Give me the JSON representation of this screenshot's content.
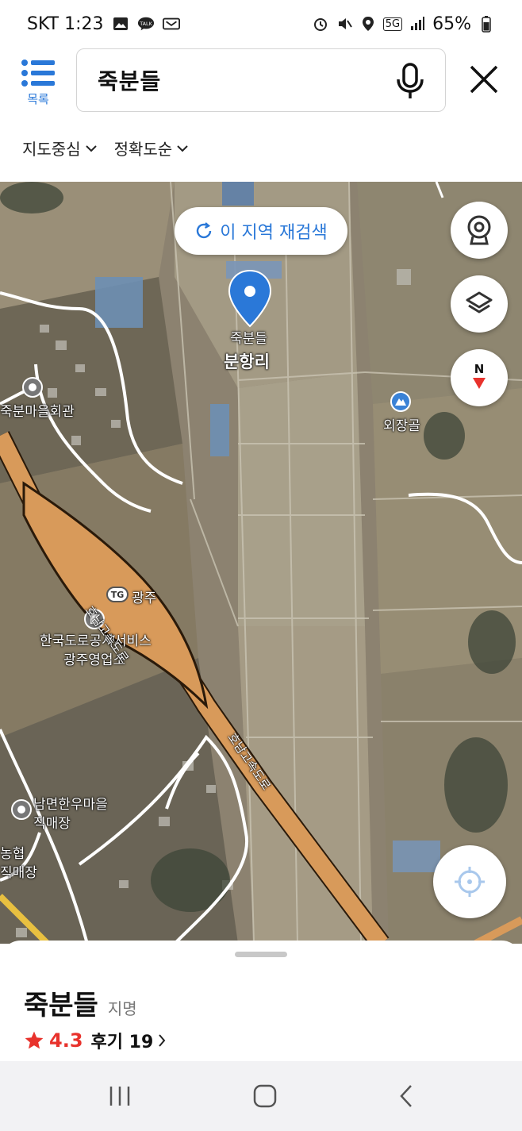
{
  "status": {
    "carrier_time": "SKT 1:23",
    "network": "5G",
    "battery": "65%"
  },
  "header": {
    "list_label": "목록",
    "search_query": "죽분들"
  },
  "filters": [
    {
      "label": "지도중심"
    },
    {
      "label": "정확도순"
    }
  ],
  "map": {
    "research_label": "이 지역 재검색",
    "pin_label": "죽분들",
    "labels": {
      "village": "분항리",
      "hall": "죽분마을회관",
      "oejang": "외장골",
      "tg": "TG",
      "gwangju": "광주",
      "office_1": "한국도로공사서비스",
      "office_2": "광주영업소",
      "shop_1": "남면한우마을",
      "shop_2": "직매장",
      "coop_1": "농협",
      "coop_2": "직매장",
      "highway_upper": "호남고속도로",
      "highway_lower": "호남고속도로"
    }
  },
  "sheet": {
    "name": "죽분들",
    "category": "지명",
    "rating": "4.3",
    "reviews": "후기 19"
  },
  "colors": {
    "accent": "#2a78d8",
    "highway": "#d89a5a",
    "star": "#e8322c"
  }
}
